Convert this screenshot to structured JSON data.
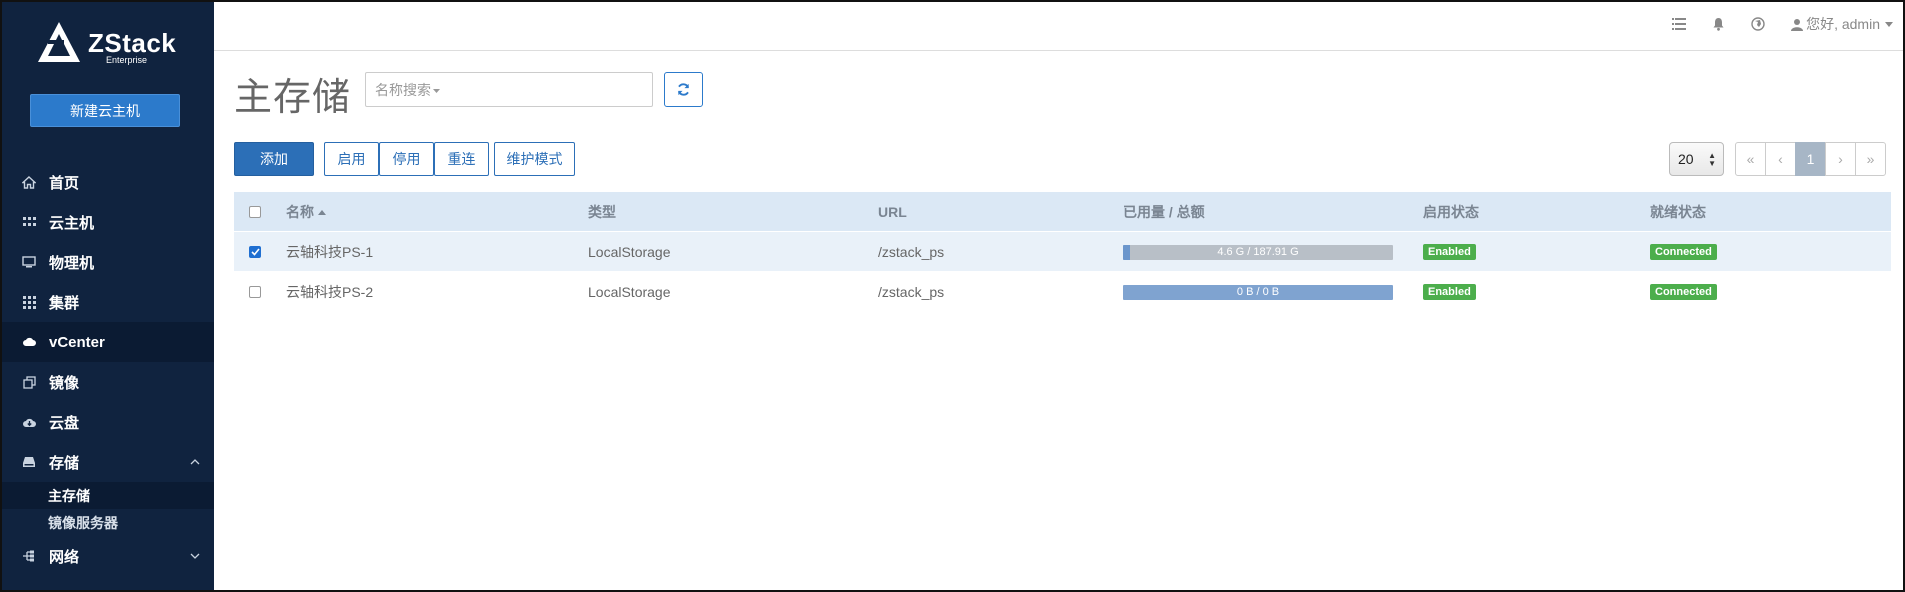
{
  "brand": {
    "name": "ZStack",
    "edition": "Enterprise"
  },
  "sidebar": {
    "new_vm_label": "新建云主机",
    "items": [
      {
        "label": "首页",
        "icon": "home-icon"
      },
      {
        "label": "云主机",
        "icon": "grid-small-icon"
      },
      {
        "label": "物理机",
        "icon": "monitor-icon"
      },
      {
        "label": "集群",
        "icon": "grid-icon"
      },
      {
        "label": "vCenter",
        "icon": "cloud-icon"
      },
      {
        "label": "镜像",
        "icon": "copy-icon"
      },
      {
        "label": "云盘",
        "icon": "cloud-download-icon"
      },
      {
        "label": "存储",
        "icon": "hdd-icon"
      },
      {
        "label": "网络",
        "icon": "network-icon"
      }
    ],
    "storage_sub": [
      "主存储",
      "镜像服务器"
    ]
  },
  "topbar": {
    "user_label": "您好, admin"
  },
  "main": {
    "title": "主存储",
    "search_placeholder": "名称搜索",
    "buttons": {
      "add": "添加",
      "enable": "启用",
      "disable": "停用",
      "reconnect": "重连",
      "maintenance": "维护模式"
    },
    "page_size": "20",
    "pager": [
      "«",
      "‹",
      "1",
      "›",
      "»"
    ]
  },
  "table": {
    "headers": {
      "name": "名称",
      "type": "类型",
      "url": "URL",
      "usage": "已用量 / 总额",
      "state": "启用状态",
      "status": "就绪状态"
    },
    "rows": [
      {
        "selected": true,
        "name": "云轴科技PS-1",
        "type": "LocalStorage",
        "url": "/zstack_ps",
        "usage": "4.6 G / 187.91 G",
        "usage_ratio": 0.0245,
        "state": "Enabled",
        "status": "Connected"
      },
      {
        "selected": false,
        "name": "云轴科技PS-2",
        "type": "LocalStorage",
        "url": "/zstack_ps",
        "usage": "0 B / 0 B",
        "usage_ratio": 0,
        "state": "Enabled",
        "status": "Connected"
      }
    ]
  },
  "colors": {
    "sidebar_bg": "#10233f",
    "primary": "#2c6fb7",
    "success": "#4cae4c",
    "table_head": "#dbe8f5"
  }
}
